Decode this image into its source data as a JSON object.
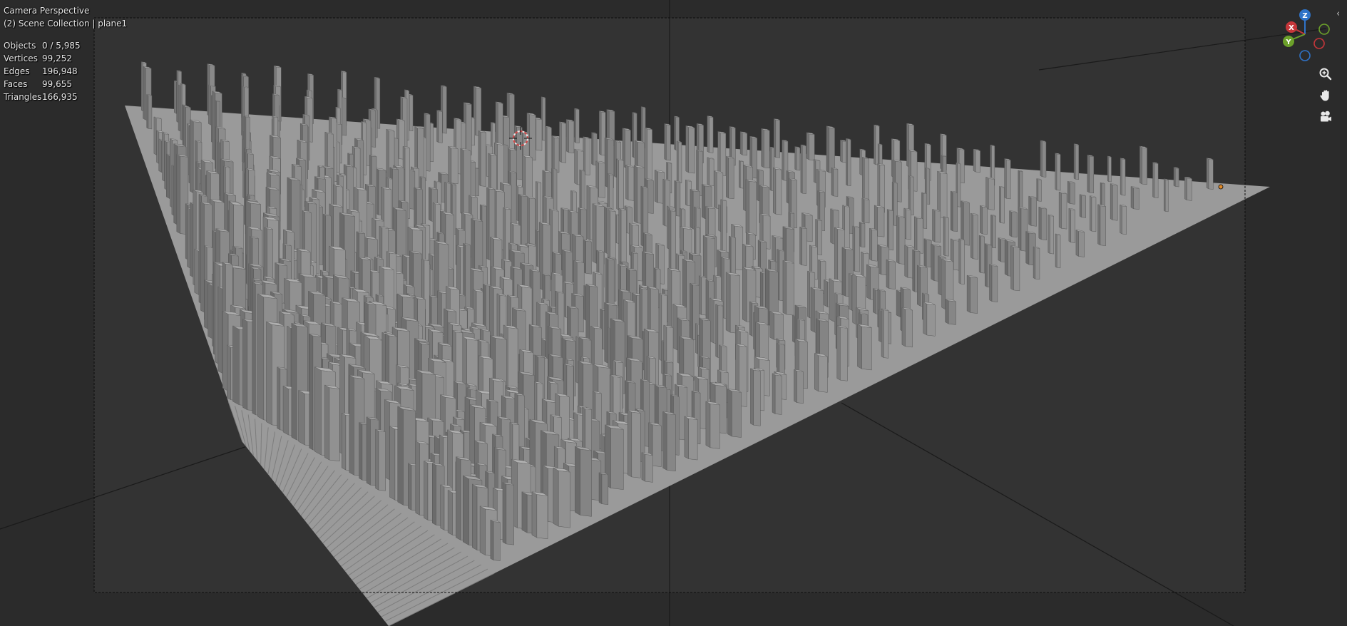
{
  "viewport": {
    "title": "Camera Perspective",
    "collection": "(2) Scene Collection | plane1"
  },
  "stats": [
    {
      "label": "Objects",
      "value": "0 / 5,985"
    },
    {
      "label": "Vertices",
      "value": "99,252"
    },
    {
      "label": "Edges",
      "value": "196,948"
    },
    {
      "label": "Faces",
      "value": "99,655"
    },
    {
      "label": "Triangles",
      "value": "166,935"
    }
  ],
  "gizmo": {
    "x_label": "X",
    "y_label": "Y",
    "z_label": "Z",
    "x_color": "#c6363a",
    "y_color": "#6ca12a",
    "z_color": "#2f73c8"
  },
  "navigation": {
    "zoom_icon": "zoom-in-icon",
    "pan_icon": "hand-icon",
    "camera_icon": "camera-icon"
  },
  "colors": {
    "background": "#2b2b2b",
    "camera_frame_fill": "#333333",
    "building_front": "#8c8c8c",
    "building_side": "#737373",
    "building_top": "#a9a9a9",
    "ground_plane": "#9a9a9a",
    "origin_dot": "#e08a2a"
  }
}
